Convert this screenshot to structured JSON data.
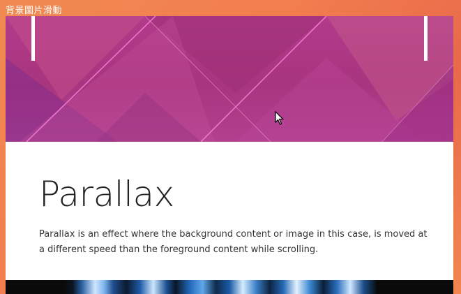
{
  "window": {
    "title": "背景圖片滑動"
  },
  "hero": {
    "image": "geometric-pink-purple-triangles"
  },
  "card": {
    "title": "Parallax",
    "description": "Parallax is an effect where the background content or image in this case, is moved at a different speed than the foreground content while scrolling."
  },
  "colors": {
    "background": "#f08a52",
    "hero_base": "#a8357f",
    "hero_line": "#f47ad4",
    "text": "#222222"
  },
  "icons": {
    "cursor": "mouse-pointer-icon"
  }
}
